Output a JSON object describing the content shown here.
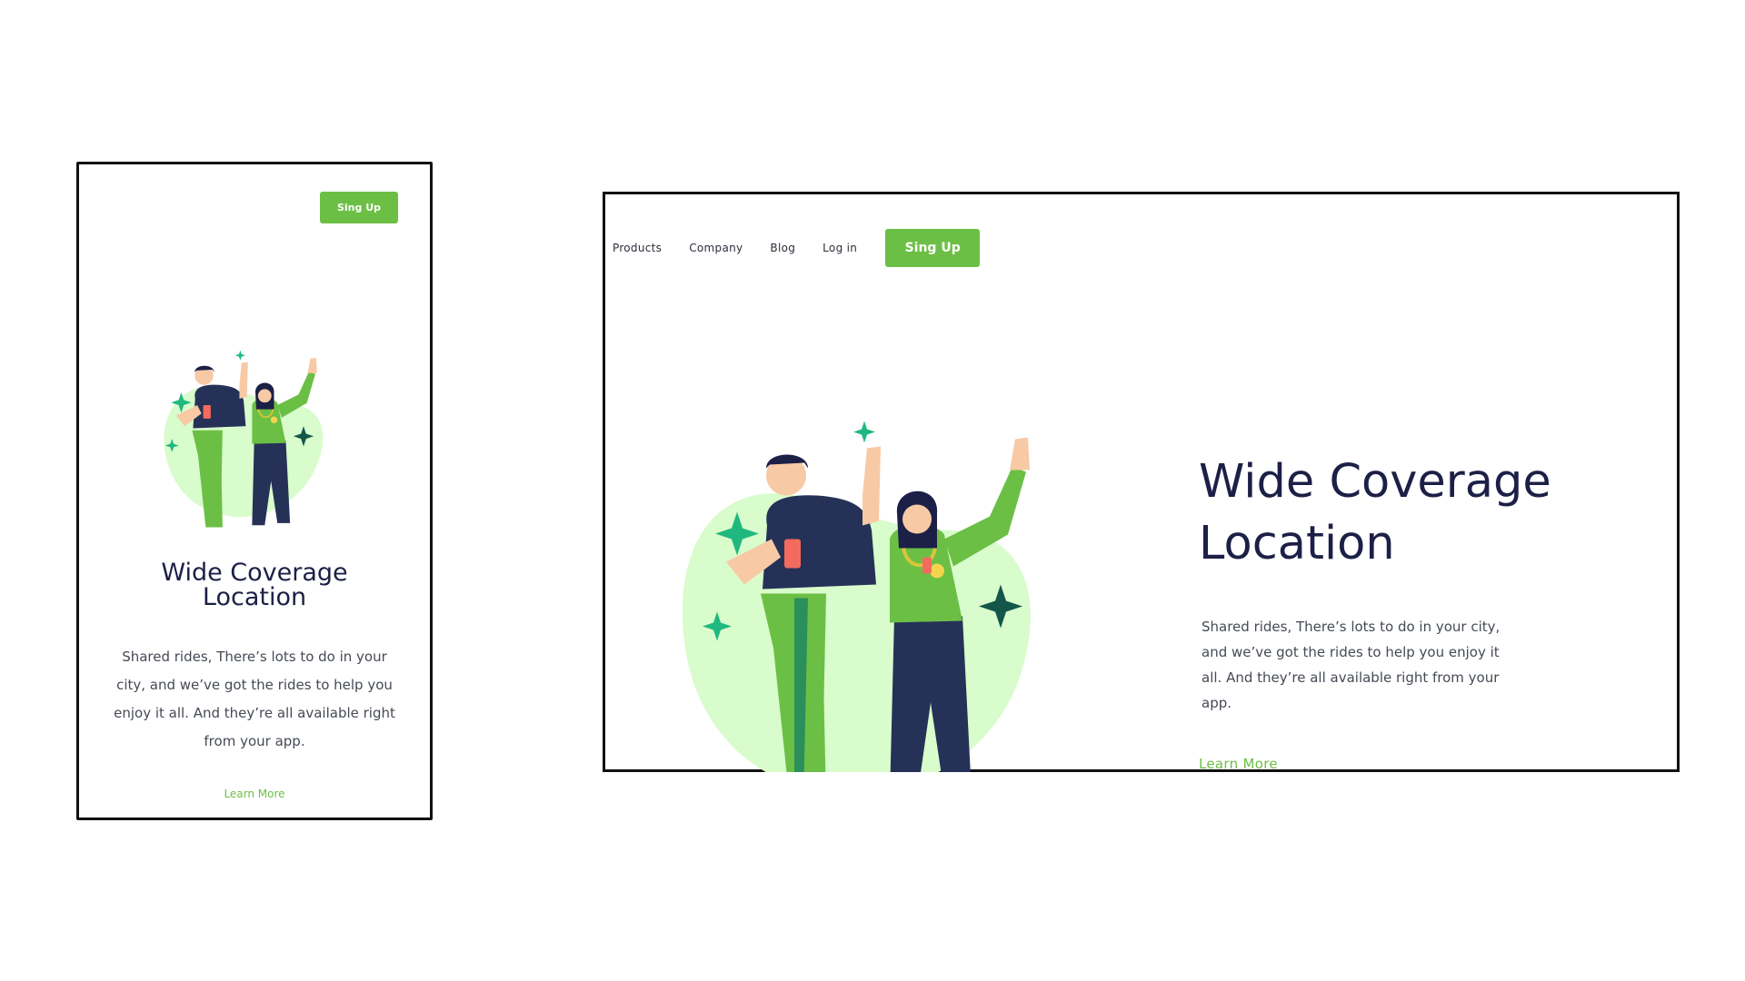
{
  "colors": {
    "accent": "#6cbf45",
    "heading": "#1c2046",
    "body_text": "#454a55",
    "blob": "#d8fccb",
    "sparkle": "#1fb87f",
    "navy": "#263158"
  },
  "mobile": {
    "signup_label": "Sing Up",
    "title_line1": "Wide Coverage",
    "title_line2": "Location",
    "body_line1": "Shared rides, There’s lots to do in your",
    "body_line2": "city, and we’ve got the rides to help you",
    "body_line3": "enjoy it all. And they’re all available right",
    "body_line4": "from your app.",
    "learn_more": "Learn More"
  },
  "desktop": {
    "nav": {
      "products": "Products",
      "company": "Company",
      "blog": "Blog",
      "login": "Log in",
      "signup_label": "Sing Up"
    },
    "title_line1": "Wide Coverage",
    "title_line2": "Location",
    "body_line1": "Shared rides, There’s lots to do in your city,",
    "body_line2": "and we’ve got the rides to help you enjoy it",
    "body_line3": "all. And they’re all available right from your",
    "body_line4": "app.",
    "learn_more": "Learn More"
  },
  "illustration": {
    "description_icon": "two-people-waving-illustration"
  }
}
